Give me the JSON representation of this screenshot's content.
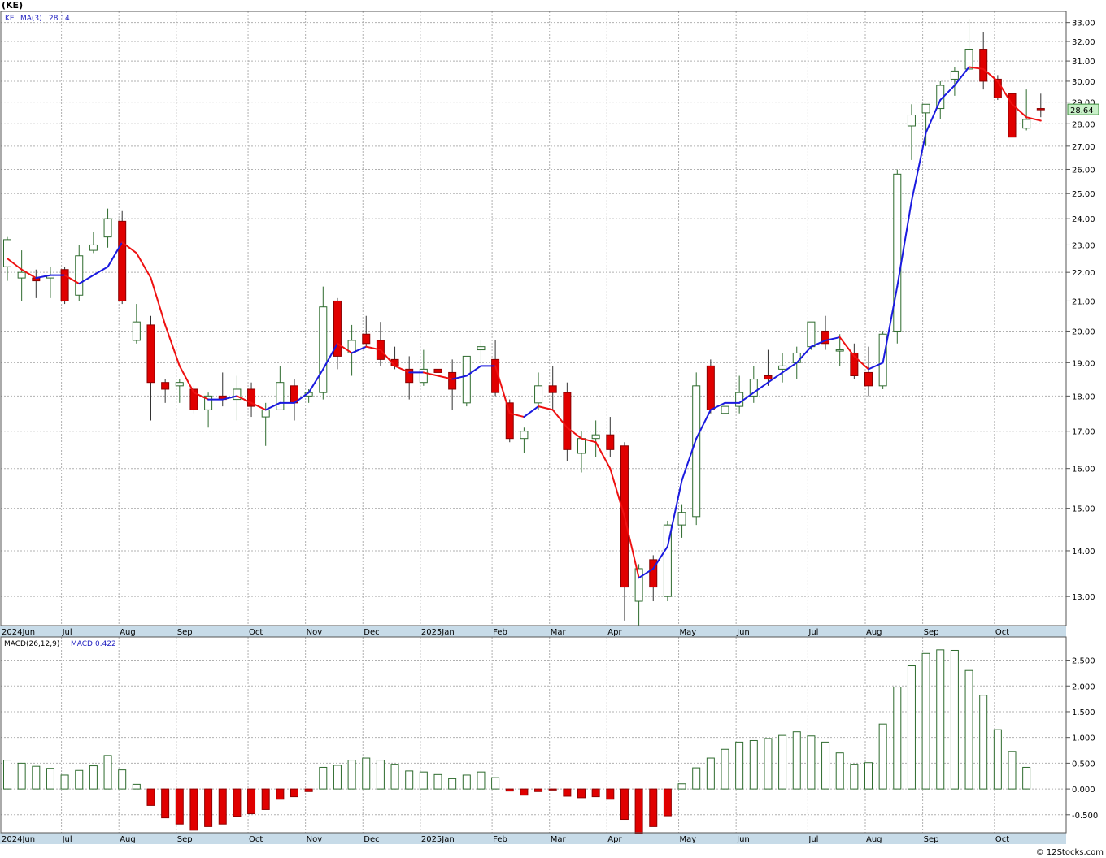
{
  "header": {
    "symbol": "(KE)",
    "legend_symbol": "KE",
    "legend_ma_label": "MA(3)",
    "legend_ma_value": "28.14",
    "macd_label": "MACD(26,12,9)",
    "macd_value_label": "MACD:0.422",
    "last_price_label": "28.64",
    "watermark": "© 12Stocks.com"
  },
  "colors": {
    "up_candle": "#2e6b2e",
    "down_candle": "#e00000",
    "ma_up": "#1a1adf",
    "ma_down": "#ee1111",
    "macd_pos": "#2e6b2e",
    "macd_neg": "#e00000",
    "grid": "#b0b0b0",
    "axis_band": "#c7dbe8",
    "price_tag": "#c8f0c8"
  },
  "chart_data": [
    {
      "type": "candlestick",
      "title": "(KE)",
      "scale": "log",
      "ylim": [
        12.4,
        33.6
      ],
      "y_ticks": [
        13.0,
        14.0,
        15.0,
        16.0,
        17.0,
        18.0,
        19.0,
        20.0,
        21.0,
        22.0,
        23.0,
        24.0,
        25.0,
        26.0,
        27.0,
        28.0,
        29.0,
        30.0,
        31.0,
        32.0,
        33.0
      ],
      "x_labels": [
        "2024Jun",
        "Jul",
        "Aug",
        "Sep",
        "Oct",
        "Nov",
        "Dec",
        "2025Jan",
        "Feb",
        "Mar",
        "Apr",
        "May",
        "Jun",
        "Jul",
        "Aug",
        "Sep",
        "Oct"
      ],
      "x_label_week_index": [
        0,
        4,
        8,
        12,
        17,
        21,
        25,
        29,
        34,
        38,
        42,
        47,
        51,
        56,
        60,
        64,
        69
      ],
      "last_price": 28.64,
      "candles": [
        {
          "o": 22.2,
          "h": 23.3,
          "l": 21.7,
          "c": 23.2
        },
        {
          "o": 21.8,
          "h": 22.8,
          "l": 21.0,
          "c": 22.0
        },
        {
          "o": 21.8,
          "h": 22.1,
          "l": 21.1,
          "c": 21.7
        },
        {
          "o": 21.8,
          "h": 22.2,
          "l": 21.1,
          "c": 21.9
        },
        {
          "o": 22.1,
          "h": 22.2,
          "l": 20.9,
          "c": 21.0
        },
        {
          "o": 21.2,
          "h": 23.0,
          "l": 21.0,
          "c": 22.6
        },
        {
          "o": 22.8,
          "h": 23.5,
          "l": 22.7,
          "c": 23.0
        },
        {
          "o": 23.3,
          "h": 24.4,
          "l": 22.9,
          "c": 24.0
        },
        {
          "o": 23.9,
          "h": 24.3,
          "l": 20.9,
          "c": 21.0
        },
        {
          "o": 19.7,
          "h": 20.9,
          "l": 19.6,
          "c": 20.3
        },
        {
          "o": 20.2,
          "h": 20.5,
          "l": 17.3,
          "c": 18.4
        },
        {
          "o": 18.4,
          "h": 18.5,
          "l": 17.8,
          "c": 18.2
        },
        {
          "o": 18.3,
          "h": 18.5,
          "l": 17.8,
          "c": 18.4
        },
        {
          "o": 18.2,
          "h": 18.3,
          "l": 17.5,
          "c": 17.6
        },
        {
          "o": 17.6,
          "h": 18.1,
          "l": 17.1,
          "c": 18.0
        },
        {
          "o": 18.0,
          "h": 18.7,
          "l": 17.7,
          "c": 17.9
        },
        {
          "o": 17.9,
          "h": 18.6,
          "l": 17.3,
          "c": 18.2
        },
        {
          "o": 18.2,
          "h": 18.4,
          "l": 17.4,
          "c": 17.7
        },
        {
          "o": 17.4,
          "h": 17.8,
          "l": 16.6,
          "c": 17.6
        },
        {
          "o": 17.6,
          "h": 18.9,
          "l": 17.6,
          "c": 18.4
        },
        {
          "o": 18.3,
          "h": 18.5,
          "l": 17.3,
          "c": 17.8
        },
        {
          "o": 18.0,
          "h": 18.2,
          "l": 17.8,
          "c": 18.1
        },
        {
          "o": 18.1,
          "h": 21.5,
          "l": 17.9,
          "c": 20.8
        },
        {
          "o": 21.0,
          "h": 21.1,
          "l": 18.8,
          "c": 19.2
        },
        {
          "o": 19.3,
          "h": 20.2,
          "l": 18.6,
          "c": 19.7
        },
        {
          "o": 19.9,
          "h": 20.5,
          "l": 19.5,
          "c": 19.6
        },
        {
          "o": 19.7,
          "h": 20.3,
          "l": 18.9,
          "c": 19.1
        },
        {
          "o": 19.1,
          "h": 19.5,
          "l": 18.8,
          "c": 18.9
        },
        {
          "o": 18.8,
          "h": 19.2,
          "l": 17.9,
          "c": 18.4
        },
        {
          "o": 18.4,
          "h": 19.4,
          "l": 18.3,
          "c": 18.8
        },
        {
          "o": 18.8,
          "h": 19.1,
          "l": 18.4,
          "c": 18.7
        },
        {
          "o": 18.7,
          "h": 19.1,
          "l": 17.6,
          "c": 18.2
        },
        {
          "o": 17.8,
          "h": 19.1,
          "l": 17.7,
          "c": 19.2
        },
        {
          "o": 19.4,
          "h": 19.7,
          "l": 19.0,
          "c": 19.5
        },
        {
          "o": 19.1,
          "h": 19.7,
          "l": 18.0,
          "c": 18.1
        },
        {
          "o": 17.8,
          "h": 17.9,
          "l": 16.7,
          "c": 16.8
        },
        {
          "o": 16.8,
          "h": 17.1,
          "l": 16.4,
          "c": 17.0
        },
        {
          "o": 17.8,
          "h": 18.7,
          "l": 17.6,
          "c": 18.3
        },
        {
          "o": 18.3,
          "h": 18.9,
          "l": 17.6,
          "c": 18.1
        },
        {
          "o": 18.1,
          "h": 18.4,
          "l": 16.2,
          "c": 16.5
        },
        {
          "o": 16.4,
          "h": 17.0,
          "l": 15.9,
          "c": 16.8
        },
        {
          "o": 16.8,
          "h": 17.3,
          "l": 16.3,
          "c": 16.9
        },
        {
          "o": 16.9,
          "h": 17.4,
          "l": 16.3,
          "c": 16.5
        },
        {
          "o": 16.6,
          "h": 16.7,
          "l": 12.5,
          "c": 13.2
        },
        {
          "o": 12.9,
          "h": 13.7,
          "l": 12.4,
          "c": 13.6
        },
        {
          "o": 13.8,
          "h": 13.9,
          "l": 12.9,
          "c": 13.2
        },
        {
          "o": 13.0,
          "h": 14.7,
          "l": 12.9,
          "c": 14.6
        },
        {
          "o": 14.6,
          "h": 15.1,
          "l": 14.3,
          "c": 14.9
        },
        {
          "o": 14.8,
          "h": 18.7,
          "l": 14.6,
          "c": 18.3
        },
        {
          "o": 18.9,
          "h": 19.1,
          "l": 17.5,
          "c": 17.6
        },
        {
          "o": 17.5,
          "h": 17.8,
          "l": 17.1,
          "c": 17.7
        },
        {
          "o": 17.7,
          "h": 18.6,
          "l": 17.5,
          "c": 18.1
        },
        {
          "o": 18.0,
          "h": 18.9,
          "l": 17.8,
          "c": 18.5
        },
        {
          "o": 18.6,
          "h": 19.4,
          "l": 18.3,
          "c": 18.5
        },
        {
          "o": 18.8,
          "h": 19.3,
          "l": 18.4,
          "c": 18.9
        },
        {
          "o": 19.0,
          "h": 19.5,
          "l": 18.5,
          "c": 19.3
        },
        {
          "o": 19.5,
          "h": 20.3,
          "l": 19.4,
          "c": 20.3
        },
        {
          "o": 20.0,
          "h": 20.5,
          "l": 19.4,
          "c": 19.6
        },
        {
          "o": 19.4,
          "h": 19.9,
          "l": 18.9,
          "c": 19.4
        },
        {
          "o": 19.3,
          "h": 19.6,
          "l": 18.5,
          "c": 18.6
        },
        {
          "o": 18.7,
          "h": 19.5,
          "l": 18.0,
          "c": 18.3
        },
        {
          "o": 18.3,
          "h": 20.0,
          "l": 18.2,
          "c": 19.9
        },
        {
          "o": 20.0,
          "h": 26.0,
          "l": 19.6,
          "c": 25.8
        },
        {
          "o": 27.9,
          "h": 28.9,
          "l": 26.4,
          "c": 28.4
        },
        {
          "o": 28.5,
          "h": 28.9,
          "l": 27.0,
          "c": 28.9
        },
        {
          "o": 28.7,
          "h": 30.0,
          "l": 28.2,
          "c": 29.8
        },
        {
          "o": 30.1,
          "h": 30.7,
          "l": 29.3,
          "c": 30.5
        },
        {
          "o": 30.6,
          "h": 33.2,
          "l": 30.5,
          "c": 31.6
        },
        {
          "o": 31.6,
          "h": 32.5,
          "l": 29.6,
          "c": 30.0
        },
        {
          "o": 30.1,
          "h": 30.3,
          "l": 29.1,
          "c": 29.2
        },
        {
          "o": 29.4,
          "h": 29.8,
          "l": 27.4,
          "c": 27.4
        },
        {
          "o": 27.8,
          "h": 29.6,
          "l": 27.7,
          "c": 28.2
        },
        {
          "o": 28.7,
          "h": 29.4,
          "l": 28.3,
          "c": 28.64
        }
      ],
      "ma3": [
        22.5,
        22.1,
        21.8,
        21.9,
        21.9,
        21.6,
        21.9,
        22.2,
        23.1,
        22.7,
        21.8,
        20.2,
        18.9,
        18.1,
        17.9,
        17.9,
        18.0,
        17.8,
        17.6,
        17.8,
        17.8,
        18.1,
        18.8,
        19.6,
        19.3,
        19.5,
        19.4,
        18.9,
        18.7,
        18.7,
        18.6,
        18.5,
        18.6,
        18.9,
        18.9,
        17.5,
        17.4,
        17.7,
        17.6,
        17.1,
        16.8,
        16.7,
        16.0,
        14.8,
        13.4,
        13.6,
        14.1,
        15.7,
        16.8,
        17.6,
        17.8,
        17.8,
        18.1,
        18.4,
        18.7,
        19.0,
        19.5,
        19.7,
        19.8,
        19.2,
        18.8,
        19.0,
        21.5,
        24.7,
        27.6,
        29.1,
        29.8,
        30.7,
        30.6,
        30.0,
        28.9,
        28.3,
        28.14
      ]
    },
    {
      "type": "bar",
      "title": "MACD(26,12,9)",
      "ylim": [
        -0.85,
        2.95
      ],
      "y_ticks": [
        -0.5,
        0.0,
        0.5,
        1.0,
        1.5,
        2.0,
        2.5
      ],
      "y_tick_labels": [
        "-0.500",
        "0.000",
        "0.500",
        "1.000",
        "1.500",
        "2.000",
        "2.500"
      ],
      "x_labels": [
        "2024Jun",
        "Jul",
        "Aug",
        "Sep",
        "Oct",
        "Nov",
        "Dec",
        "2025Jan",
        "Feb",
        "Mar",
        "Apr",
        "May",
        "Jun",
        "Jul",
        "Aug",
        "Sep",
        "Oct"
      ],
      "values": [
        0.56,
        0.5,
        0.44,
        0.4,
        0.27,
        0.36,
        0.45,
        0.65,
        0.37,
        0.09,
        -0.32,
        -0.56,
        -0.68,
        -0.8,
        -0.73,
        -0.68,
        -0.53,
        -0.48,
        -0.4,
        -0.2,
        -0.15,
        -0.05,
        0.42,
        0.46,
        0.56,
        0.6,
        0.56,
        0.48,
        0.35,
        0.33,
        0.28,
        0.2,
        0.27,
        0.33,
        0.22,
        -0.04,
        -0.12,
        -0.05,
        -0.02,
        -0.14,
        -0.17,
        -0.15,
        -0.2,
        -0.59,
        -0.86,
        -0.73,
        -0.52,
        0.1,
        0.41,
        0.6,
        0.77,
        0.91,
        0.94,
        0.98,
        1.04,
        1.11,
        1.03,
        0.91,
        0.7,
        0.48,
        0.51,
        1.26,
        1.98,
        2.39,
        2.63,
        2.7,
        2.69,
        2.3,
        1.82,
        1.15,
        0.73,
        0.42
      ]
    }
  ]
}
